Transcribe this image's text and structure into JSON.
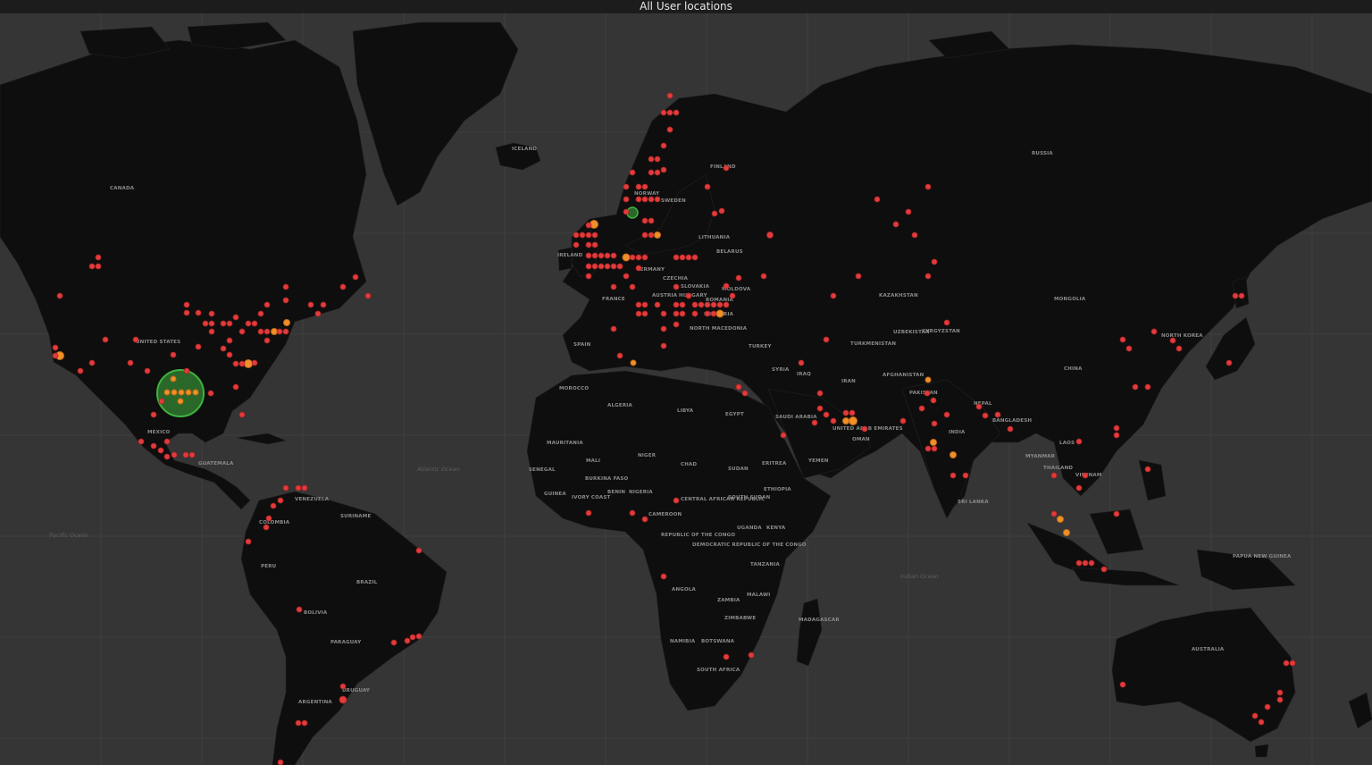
{
  "panel": {
    "title": "All User locations"
  },
  "colors": {
    "background": "#353535",
    "land": "#0e0e0e",
    "dot_red": "#e23b3b",
    "dot_orange": "#f0902a",
    "cluster_green": "#3fb33f"
  },
  "countries": [
    "CANADA",
    "ICELAND",
    "FINLAND",
    "NORWAY",
    "SWEDEN",
    "RUSSIA",
    "LITHUANIA",
    "BELARUS",
    "IRELAND",
    "GERMANY",
    "FRANCE",
    "CZECHIA",
    "SLOVAKIA",
    "AUSTRIA",
    "HUNGARY",
    "MOLDOVA",
    "ROMANIA",
    "BULGARIA",
    "NORTH MACEDONIA",
    "SPAIN",
    "TURKEY",
    "SYRIA",
    "IRAQ",
    "IRAN",
    "KAZAKHSTAN",
    "UZBEKISTAN",
    "TURKMENISTAN",
    "KYRGYZSTAN",
    "AFGHANISTAN",
    "PAKISTAN",
    "MONGOLIA",
    "CHINA",
    "NORTH KOREA",
    "UNITED STATES",
    "MEXICO",
    "GUATEMALA",
    "MOROCCO",
    "ALGERIA",
    "LIBYA",
    "EGYPT",
    "SAUDI ARABIA",
    "UNITED ARAB EMIRATES",
    "OMAN",
    "YEMEN",
    "ERITREA",
    "SUDAN",
    "SOUTH SUDAN",
    "ETHIOPIA",
    "MAURITANIA",
    "MALI",
    "NIGER",
    "CHAD",
    "SENEGAL",
    "BURKINA FASO",
    "GUINEA",
    "IVORY COAST",
    "NIGERIA",
    "BENIN",
    "CENTRAL AFRICAN REPUBLIC",
    "CAMEROON",
    "REPUBLIC OF THE CONGO",
    "DEMOCRATIC REPUBLIC OF THE CONGO",
    "UGANDA",
    "KENYA",
    "TANZANIA",
    "ANGOLA",
    "ZAMBIA",
    "MALAWI",
    "ZIMBABWE",
    "NAMIBIA",
    "BOTSWANA",
    "SOUTH AFRICA",
    "MADAGASCAR",
    "INDIA",
    "NEPAL",
    "BANGLADESH",
    "SRI LANKA",
    "MYANMAR",
    "LAOS",
    "THAILAND",
    "VIETNAM",
    "VENEZUELA",
    "SURINAME",
    "COLOMBIA",
    "PERU",
    "BRAZIL",
    "BOLIVIA",
    "PARAGUAY",
    "URUGUAY",
    "ARGENTINA",
    "AUSTRALIA",
    "PAPUA NEW GUINEA"
  ],
  "oceans": [
    "Atlantic Ocean",
    "Pacific Ocean",
    "Indian Ocean"
  ]
}
